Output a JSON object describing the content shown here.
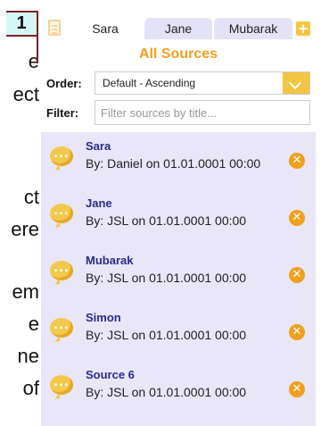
{
  "background_text": [
    "e",
    "ect",
    "ct",
    "ere",
    "em",
    "e",
    "ne",
    "of"
  ],
  "step_badge": "1",
  "tabs": [
    {
      "label": "Sara",
      "active": true
    },
    {
      "label": "Jane",
      "active": false
    },
    {
      "label": "Mubarak",
      "active": false
    }
  ],
  "title": "All Sources",
  "order": {
    "label": "Order:",
    "value": "Default - Ascending"
  },
  "filter": {
    "label": "Filter:",
    "placeholder": "Filter sources by title...",
    "value": ""
  },
  "sources": [
    {
      "name": "Sara",
      "subtitle": "By: Daniel on 01.01.0001 00:00"
    },
    {
      "name": "Jane",
      "subtitle": "By: JSL on 01.01.0001 00:00"
    },
    {
      "name": "Mubarak",
      "subtitle": "By: JSL on 01.01.0001 00:00"
    },
    {
      "name": "Simon",
      "subtitle": "By: JSL on 01.01.0001 00:00"
    },
    {
      "name": "Source 6",
      "subtitle": "By: JSL on 01.01.0001 00:00"
    }
  ],
  "icons": {
    "document": "document-icon",
    "add": "plus-icon",
    "chat": "chat-bubble-icon",
    "remove": "remove-icon",
    "dropdown": "chevron-down-icon"
  },
  "colors": {
    "accent": "#f0a01e",
    "list_bg": "#e8e6f7",
    "name_text": "#2a2a8e",
    "tab_inactive": "#e4e2f6"
  }
}
